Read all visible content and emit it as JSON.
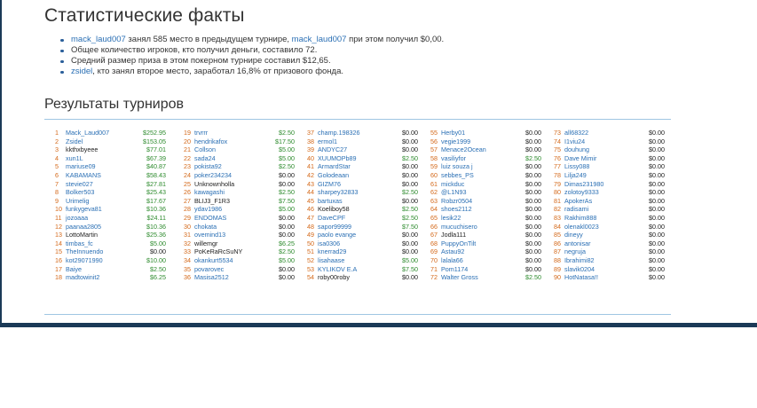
{
  "page": {
    "title": "Статистические факты",
    "results_title": "Результаты турниров"
  },
  "facts": [
    {
      "parts": [
        {
          "text": "mack_laud007",
          "link": true
        },
        {
          "text": " занял 585 место в предыдущем турнире, ",
          "link": false
        },
        {
          "text": "mack_laud007",
          "link": true
        },
        {
          "text": " при этом получил $0,00.",
          "link": false
        }
      ]
    },
    {
      "parts": [
        {
          "text": "Общее количество игроков, кто получил деньги, составило 72.",
          "link": false
        }
      ]
    },
    {
      "parts": [
        {
          "text": "Средний размер приза в этом покерном турнире составил $12,65.",
          "link": false
        }
      ]
    },
    {
      "parts": [
        {
          "text": "zsidel",
          "link": true
        },
        {
          "text": ", кто занял второе место, заработал 16,8% от призового фонда.",
          "link": false
        }
      ]
    }
  ],
  "results_columns": [
    [
      {
        "pos": "1",
        "name": "Mack_Laud007",
        "amount": "$252.95",
        "dark": false,
        "green": true
      },
      {
        "pos": "2",
        "name": "Zsidel",
        "amount": "$153.05",
        "dark": false,
        "green": true
      },
      {
        "pos": "3",
        "name": "kkthxbyeee",
        "amount": "$77.01",
        "dark": true,
        "green": true
      },
      {
        "pos": "4",
        "name": "xun1L",
        "amount": "$67.39",
        "dark": false,
        "green": true
      },
      {
        "pos": "5",
        "name": "mariuse09",
        "amount": "$40.87",
        "dark": false,
        "green": true
      },
      {
        "pos": "6",
        "name": "KABAMANS",
        "amount": "$58.43",
        "dark": false,
        "green": true
      },
      {
        "pos": "7",
        "name": "stevie027",
        "amount": "$27.81",
        "dark": false,
        "green": true
      },
      {
        "pos": "8",
        "name": "Bolker503",
        "amount": "$25.43",
        "dark": false,
        "green": true
      },
      {
        "pos": "9",
        "name": "Urimelig",
        "amount": "$17.67",
        "dark": false,
        "green": true
      },
      {
        "pos": "10",
        "name": "funkygeva81",
        "amount": "$10.36",
        "dark": false,
        "green": true
      },
      {
        "pos": "11",
        "name": "jozoaaa",
        "amount": "$24.11",
        "dark": false,
        "green": true
      },
      {
        "pos": "12",
        "name": "paanaa2805",
        "amount": "$10.36",
        "dark": false,
        "green": true
      },
      {
        "pos": "13",
        "name": "LottoMartin",
        "amount": "$25.36",
        "dark": true,
        "green": true
      },
      {
        "pos": "14",
        "name": "timbas_fc",
        "amount": "$5.00",
        "dark": false,
        "green": true
      },
      {
        "pos": "15",
        "name": "TheInnuendo",
        "amount": "$0.00",
        "dark": false,
        "green": false
      },
      {
        "pos": "16",
        "name": "kot29071990",
        "amount": "$10.00",
        "dark": false,
        "green": true
      },
      {
        "pos": "17",
        "name": "Baiye",
        "amount": "$2.50",
        "dark": false,
        "green": true
      },
      {
        "pos": "18",
        "name": "madtowinit2",
        "amount": "$6.25",
        "dark": false,
        "green": true
      }
    ],
    [
      {
        "pos": "19",
        "name": "trvrrr",
        "amount": "$2.50",
        "dark": false,
        "green": true
      },
      {
        "pos": "20",
        "name": "hendrikafox",
        "amount": "$17.50",
        "dark": false,
        "green": true
      },
      {
        "pos": "21",
        "name": "Collson",
        "amount": "$5.00",
        "dark": false,
        "green": true
      },
      {
        "pos": "22",
        "name": "sada24",
        "amount": "$5.00",
        "dark": false,
        "green": true
      },
      {
        "pos": "23",
        "name": "pokista92",
        "amount": "$2.50",
        "dark": false,
        "green": true
      },
      {
        "pos": "24",
        "name": "poker234234",
        "amount": "$0.00",
        "dark": false,
        "green": false
      },
      {
        "pos": "25",
        "name": "Unknownholla",
        "amount": "$0.00",
        "dark": true,
        "green": false
      },
      {
        "pos": "26",
        "name": "kawagashi",
        "amount": "$2.50",
        "dark": false,
        "green": true
      },
      {
        "pos": "27",
        "name": "BLIJ3_F1R3",
        "amount": "$7.50",
        "dark": true,
        "green": true
      },
      {
        "pos": "28",
        "name": "ydav1986",
        "amount": "$5.00",
        "dark": false,
        "green": true
      },
      {
        "pos": "29",
        "name": "ENDOMAS",
        "amount": "$0.00",
        "dark": false,
        "green": false
      },
      {
        "pos": "30",
        "name": "chokata",
        "amount": "$0.00",
        "dark": false,
        "green": false
      },
      {
        "pos": "31",
        "name": "ovemind13",
        "amount": "$0.00",
        "dark": false,
        "green": false
      },
      {
        "pos": "32",
        "name": "willemgr",
        "amount": "$6.25",
        "dark": true,
        "green": true
      },
      {
        "pos": "33",
        "name": "PoKeRaRcSuNY",
        "amount": "$2.50",
        "dark": true,
        "green": true
      },
      {
        "pos": "34",
        "name": "okankurt5534",
        "amount": "$5.00",
        "dark": false,
        "green": true
      },
      {
        "pos": "35",
        "name": "povarovec",
        "amount": "$0.00",
        "dark": false,
        "green": false
      },
      {
        "pos": "36",
        "name": "Masisa2512",
        "amount": "$0.00",
        "dark": false,
        "green": false
      }
    ],
    [
      {
        "pos": "37",
        "name": "champ.198326",
        "amount": "$0.00",
        "dark": false,
        "green": false
      },
      {
        "pos": "38",
        "name": "ermol1",
        "amount": "$0.00",
        "dark": false,
        "green": false
      },
      {
        "pos": "39",
        "name": "ANDYC27",
        "amount": "$0.00",
        "dark": false,
        "green": false
      },
      {
        "pos": "40",
        "name": "XUUMOPb89",
        "amount": "$2.50",
        "dark": false,
        "green": true
      },
      {
        "pos": "41",
        "name": "ArmardStar",
        "amount": "$0.00",
        "dark": false,
        "green": false
      },
      {
        "pos": "42",
        "name": "Golodeaan",
        "amount": "$0.00",
        "dark": false,
        "green": false
      },
      {
        "pos": "43",
        "name": "GIZM76",
        "amount": "$0.00",
        "dark": false,
        "green": false
      },
      {
        "pos": "44",
        "name": "sharpey32833",
        "amount": "$2.50",
        "dark": false,
        "green": true
      },
      {
        "pos": "45",
        "name": "bartuxas",
        "amount": "$0.00",
        "dark": false,
        "green": false
      },
      {
        "pos": "46",
        "name": "Koeliboy58",
        "amount": "$2.50",
        "dark": true,
        "green": true
      },
      {
        "pos": "47",
        "name": "DaveCPF",
        "amount": "$2.50",
        "dark": false,
        "green": true
      },
      {
        "pos": "48",
        "name": "sapor99999",
        "amount": "$7.50",
        "dark": false,
        "green": true
      },
      {
        "pos": "49",
        "name": "paolo evange",
        "amount": "$0.00",
        "dark": false,
        "green": false
      },
      {
        "pos": "50",
        "name": "isa0306",
        "amount": "$0.00",
        "dark": false,
        "green": false
      },
      {
        "pos": "51",
        "name": "knerrad29",
        "amount": "$0.00",
        "dark": false,
        "green": false
      },
      {
        "pos": "52",
        "name": "lisahaase",
        "amount": "$5.00",
        "dark": false,
        "green": true
      },
      {
        "pos": "53",
        "name": "KYLIKOV E.A",
        "amount": "$7.50",
        "dark": false,
        "green": true
      },
      {
        "pos": "54",
        "name": "roby00roby",
        "amount": "$0.00",
        "dark": true,
        "green": false
      }
    ],
    [
      {
        "pos": "55",
        "name": "Herby01",
        "amount": "$0.00",
        "dark": false,
        "green": false
      },
      {
        "pos": "56",
        "name": "vegie1999",
        "amount": "$0.00",
        "dark": false,
        "green": false
      },
      {
        "pos": "57",
        "name": "Menace2Ocean",
        "amount": "$0.00",
        "dark": false,
        "green": false
      },
      {
        "pos": "58",
        "name": "vasiliyfor",
        "amount": "$2.50",
        "dark": false,
        "green": true
      },
      {
        "pos": "59",
        "name": "luiz souza j",
        "amount": "$0.00",
        "dark": false,
        "green": false
      },
      {
        "pos": "60",
        "name": "sebbes_PS",
        "amount": "$0.00",
        "dark": false,
        "green": false
      },
      {
        "pos": "61",
        "name": "mickduc",
        "amount": "$0.00",
        "dark": false,
        "green": false
      },
      {
        "pos": "62",
        "name": "@L1N93",
        "amount": "$0.00",
        "dark": false,
        "green": false
      },
      {
        "pos": "63",
        "name": "Robzr0504",
        "amount": "$0.00",
        "dark": false,
        "green": false
      },
      {
        "pos": "64",
        "name": "shoes2112",
        "amount": "$0.00",
        "dark": false,
        "green": false
      },
      {
        "pos": "65",
        "name": "lesik22",
        "amount": "$0.00",
        "dark": false,
        "green": false
      },
      {
        "pos": "66",
        "name": "mucuchisero",
        "amount": "$0.00",
        "dark": false,
        "green": false
      },
      {
        "pos": "67",
        "name": "Jodla111",
        "amount": "$0.00",
        "dark": true,
        "green": false
      },
      {
        "pos": "68",
        "name": "PuppyOnTilt",
        "amount": "$0.00",
        "dark": false,
        "green": false
      },
      {
        "pos": "69",
        "name": "Astau92",
        "amount": "$0.00",
        "dark": false,
        "green": false
      },
      {
        "pos": "70",
        "name": "lalala66",
        "amount": "$0.00",
        "dark": false,
        "green": false
      },
      {
        "pos": "71",
        "name": "Pom1174",
        "amount": "$0.00",
        "dark": false,
        "green": false
      },
      {
        "pos": "72",
        "name": "Walter Gross",
        "amount": "$2.50",
        "dark": false,
        "green": true
      }
    ],
    [
      {
        "pos": "73",
        "name": "all68322",
        "amount": "$0.00",
        "dark": false,
        "green": false
      },
      {
        "pos": "74",
        "name": "I1viu24",
        "amount": "$0.00",
        "dark": false,
        "green": false
      },
      {
        "pos": "75",
        "name": "douhung",
        "amount": "$0.00",
        "dark": false,
        "green": false
      },
      {
        "pos": "76",
        "name": "Dave Mimir",
        "amount": "$0.00",
        "dark": false,
        "green": false
      },
      {
        "pos": "77",
        "name": "Lissy088",
        "amount": "$0.00",
        "dark": false,
        "green": false
      },
      {
        "pos": "78",
        "name": "Lilja249",
        "amount": "$0.00",
        "dark": false,
        "green": false
      },
      {
        "pos": "79",
        "name": "Dimas231980",
        "amount": "$0.00",
        "dark": false,
        "green": false
      },
      {
        "pos": "80",
        "name": "zolotoy9333",
        "amount": "$0.00",
        "dark": false,
        "green": false
      },
      {
        "pos": "81",
        "name": "ApokerAs",
        "amount": "$0.00",
        "dark": false,
        "green": false
      },
      {
        "pos": "82",
        "name": "radisami",
        "amount": "$0.00",
        "dark": false,
        "green": false
      },
      {
        "pos": "83",
        "name": "Rakhim888",
        "amount": "$0.00",
        "dark": false,
        "green": false
      },
      {
        "pos": "84",
        "name": "olenakl0023",
        "amount": "$0.00",
        "dark": false,
        "green": false
      },
      {
        "pos": "85",
        "name": "dineyy",
        "amount": "$0.00",
        "dark": false,
        "green": false
      },
      {
        "pos": "86",
        "name": "antonisar",
        "amount": "$0.00",
        "dark": false,
        "green": false
      },
      {
        "pos": "87",
        "name": "negruja",
        "amount": "$0.00",
        "dark": false,
        "green": false
      },
      {
        "pos": "88",
        "name": "Ibrahimi82",
        "amount": "$0.00",
        "dark": false,
        "green": false
      },
      {
        "pos": "89",
        "name": "slavik0204",
        "amount": "$0.00",
        "dark": false,
        "green": false
      },
      {
        "pos": "90",
        "name": "HotNatasa!!",
        "amount": "$0.00",
        "dark": false,
        "green": false
      }
    ]
  ],
  "colors": {
    "link": "#2a6fb4",
    "position": "#d4691a",
    "prize": "#2e8b2e",
    "rule": "#9fc6e3",
    "frame": "#1b3a57"
  }
}
